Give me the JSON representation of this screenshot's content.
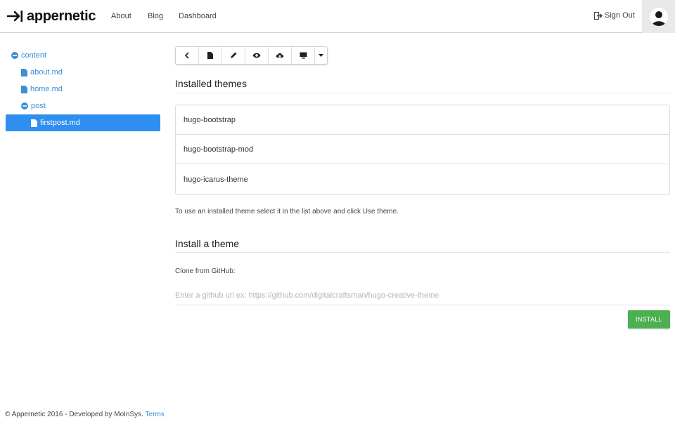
{
  "brand": {
    "name": "appernetic"
  },
  "nav": {
    "about": "About",
    "blog": "Blog",
    "dashboard": "Dashboard",
    "sign_out": "Sign Out"
  },
  "tree": {
    "root": "content",
    "items": [
      {
        "label": "about.md",
        "type": "file"
      },
      {
        "label": "home.md",
        "type": "file"
      },
      {
        "label": "post",
        "type": "folder"
      },
      {
        "label": "firstpost.md",
        "type": "file",
        "selected": true
      }
    ]
  },
  "toolbar": {
    "buttons": [
      "back-icon",
      "file-icon",
      "pencil-icon",
      "eye-icon",
      "cloud-upload-icon",
      "monitor-icon",
      "caret-down-icon"
    ]
  },
  "installed": {
    "title": "Installed themes",
    "themes": [
      "hugo-bootstrap",
      "hugo-bootstrap-mod",
      "hugo-icarus-theme"
    ],
    "help": "To use an installed theme select it in the list above and click Use theme."
  },
  "install": {
    "title": "Install a theme",
    "clone_label": "Clone from GitHub:",
    "url_value": "",
    "url_placeholder": "Enter a github url ex: https://github.com/digitalcraftsman/hugo-creative-theme",
    "button_label": "INSTALL"
  },
  "footer": {
    "text": "© Appernetic 2016 - Developed by MoInSys.",
    "terms": "Terms"
  },
  "colors": {
    "accent": "#2f8ff0",
    "link": "#3a8fd6",
    "install_button": "#4caf50"
  }
}
